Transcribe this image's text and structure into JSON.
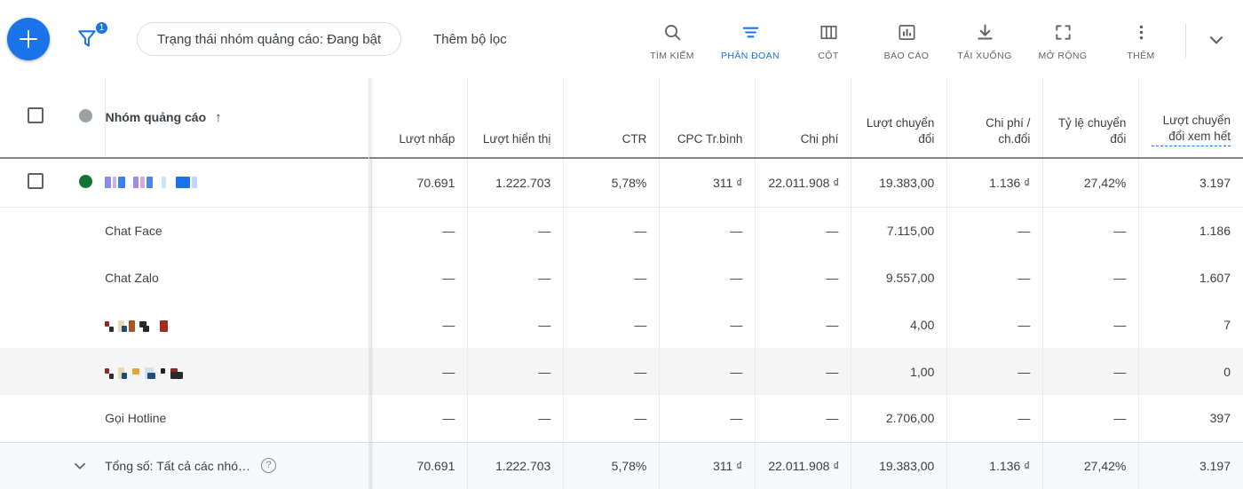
{
  "toolbar": {
    "add_button_label": "+",
    "filter_badge_count": "1",
    "filter_chip_label": "Trạng thái nhóm quảng cáo: Đang bật",
    "add_filter_label": "Thêm bộ lọc",
    "items": [
      {
        "label": "TÌM KIẾM",
        "icon": "search-icon",
        "active": false
      },
      {
        "label": "PHÂN ĐOẠN",
        "icon": "segment-icon",
        "active": true
      },
      {
        "label": "CỘT",
        "icon": "columns-icon",
        "active": false
      },
      {
        "label": "BÁO CÁO",
        "icon": "report-chart-icon",
        "active": false
      },
      {
        "label": "TẢI XUỐNG",
        "icon": "download-icon",
        "active": false
      },
      {
        "label": "MỞ RỘNG",
        "icon": "expand-icon",
        "active": false
      },
      {
        "label": "THÊM",
        "icon": "more-vertical-icon",
        "active": false
      }
    ],
    "collapse_icon": "chevron-down-icon",
    "accent_color": "#1a73e8"
  },
  "table": {
    "columns": [
      {
        "key": "checkbox",
        "label": ""
      },
      {
        "key": "status",
        "label": ""
      },
      {
        "key": "name",
        "label": "Nhóm quảng cáo",
        "sort": "↑"
      },
      {
        "key": "clicks",
        "label": "Lượt nhấp"
      },
      {
        "key": "impressions",
        "label": "Lượt hiển thị"
      },
      {
        "key": "ctr",
        "label": "CTR"
      },
      {
        "key": "avg_cpc",
        "label": "CPC Tr.bình"
      },
      {
        "key": "cost",
        "label": "Chi phí"
      },
      {
        "key": "conversions",
        "label": "Lượt chuyển đổi"
      },
      {
        "key": "cost_per_conv",
        "label": "Chi phí / ch.đổi"
      },
      {
        "key": "conv_rate",
        "label": "Tỷ lệ chuyển đổi"
      },
      {
        "key": "all_conv",
        "label": "Lượt chuyển đổi xem hết"
      }
    ],
    "header_status_dot_color": "#9aa0a6",
    "rows": [
      {
        "type": "main",
        "checkbox": true,
        "status_dot_color": "#137333",
        "name": "",
        "name_redacted": true,
        "redaction_style": "blue",
        "clicks": "70.691",
        "impressions": "1.222.703",
        "ctr": "5,78%",
        "avg_cpc": "311 ₫",
        "cost": "22.011.908 ₫",
        "conversions": "19.383,00",
        "cost_per_conv": "1.136 ₫",
        "conv_rate": "27,42%",
        "all_conv": "3.197"
      },
      {
        "type": "sub",
        "name": "Chat Face",
        "name_redacted": false,
        "clicks": "—",
        "impressions": "—",
        "ctr": "—",
        "avg_cpc": "—",
        "cost": "—",
        "conversions": "7.115,00",
        "cost_per_conv": "—",
        "conv_rate": "—",
        "all_conv": "1.186"
      },
      {
        "type": "sub",
        "name": "Chat Zalo",
        "name_redacted": false,
        "clicks": "—",
        "impressions": "—",
        "ctr": "—",
        "avg_cpc": "—",
        "cost": "—",
        "conversions": "9.557,00",
        "cost_per_conv": "—",
        "conv_rate": "—",
        "all_conv": "1.607"
      },
      {
        "type": "sub",
        "name": "",
        "name_redacted": true,
        "redaction_style": "dark-short",
        "clicks": "—",
        "impressions": "—",
        "ctr": "—",
        "avg_cpc": "—",
        "cost": "—",
        "conversions": "4,00",
        "cost_per_conv": "—",
        "conv_rate": "—",
        "all_conv": "7"
      },
      {
        "type": "sub",
        "hovered": true,
        "name": "",
        "name_redacted": true,
        "redaction_style": "dark-long",
        "clicks": "—",
        "impressions": "—",
        "ctr": "—",
        "avg_cpc": "—",
        "cost": "—",
        "conversions": "1,00",
        "cost_per_conv": "—",
        "conv_rate": "—",
        "all_conv": "0"
      },
      {
        "type": "sub",
        "name": "Gọi Hotline",
        "name_redacted": false,
        "clicks": "—",
        "impressions": "—",
        "ctr": "—",
        "avg_cpc": "—",
        "cost": "—",
        "conversions": "2.706,00",
        "cost_per_conv": "—",
        "conv_rate": "—",
        "all_conv": "397"
      }
    ],
    "total_row": {
      "expand_icon": "chevron-down-icon",
      "label": "Tổng số: Tất cả các nhó…",
      "help_icon": "help-circle-icon",
      "clicks": "70.691",
      "impressions": "1.222.703",
      "ctr": "5,78%",
      "avg_cpc": "311 ₫",
      "cost": "22.011.908 ₫",
      "conversions": "19.383,00",
      "cost_per_conv": "1.136 ₫",
      "conv_rate": "27,42%",
      "all_conv": "3.197"
    }
  }
}
